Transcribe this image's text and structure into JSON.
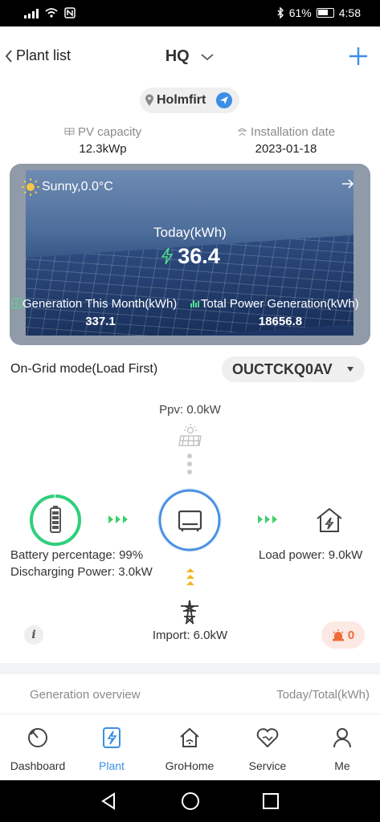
{
  "status_bar": {
    "battery": "61%",
    "time": "4:58"
  },
  "header": {
    "back_label": "Plant list",
    "title": "HQ"
  },
  "location": {
    "name": "Holmfirt"
  },
  "pv_capacity": {
    "label": "PV capacity",
    "value": "12.3kWp"
  },
  "installation_date": {
    "label": "Installation date",
    "value": "2023-01-18"
  },
  "hero": {
    "weather": "Sunny,0.0°C",
    "today_label": "Today(kWh)",
    "today_value": "36.4",
    "month_label": "Generation This Month(kWh)",
    "month_value": "337.1",
    "total_label": "Total Power Generation(kWh)",
    "total_value": "18656.8"
  },
  "mode": {
    "label": "On-Grid mode(Load First)",
    "device": "OUCTCKQ0AV"
  },
  "flow": {
    "ppv": "Ppv: 0.0kW",
    "battery_pct": "Battery percentage: 99%",
    "discharging": "Discharging Power: 3.0kW",
    "load": "Load power: 9.0kW",
    "import": "Import: 6.0kW",
    "alarm_count": "0",
    "info_glyph": "i",
    "battery_level": 0.99
  },
  "overview": {
    "title": "Generation overview",
    "unit": "Today/Total(kWh)"
  },
  "tabs": [
    {
      "label": "Dashboard",
      "icon": "dashboard-icon"
    },
    {
      "label": "Plant",
      "icon": "plant-icon"
    },
    {
      "label": "GroHome",
      "icon": "home-icon"
    },
    {
      "label": "Service",
      "icon": "service-icon"
    },
    {
      "label": "Me",
      "icon": "person-icon"
    }
  ],
  "colors": {
    "accent": "#3b8fe4",
    "battery_green": "#2fd07a",
    "arrow_green": "#3fcf6a",
    "alarm": "#f06a35",
    "import_arrow": "#f2b71f"
  }
}
